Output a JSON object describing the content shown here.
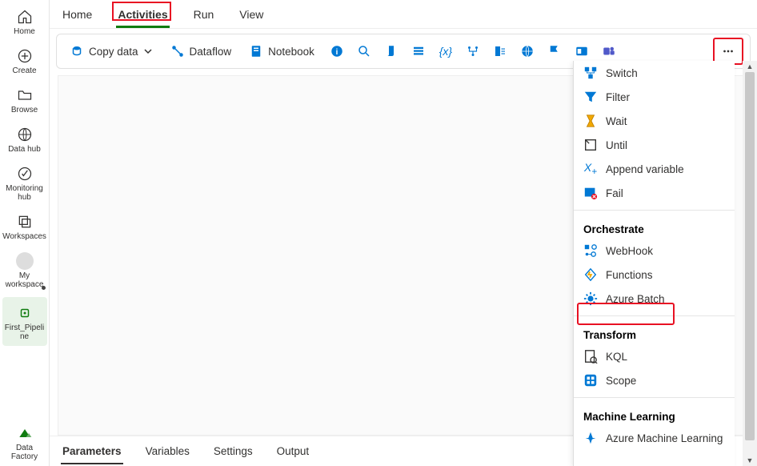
{
  "leftnav": {
    "items": [
      {
        "label": "Home",
        "icon": "home-icon"
      },
      {
        "label": "Create",
        "icon": "plus-circle-icon"
      },
      {
        "label": "Browse",
        "icon": "folder-icon"
      },
      {
        "label": "Data hub",
        "icon": "globe-icon"
      },
      {
        "label": "Monitoring\nhub",
        "icon": "monitor-icon"
      },
      {
        "label": "Workspaces",
        "icon": "workspaces-icon"
      },
      {
        "label": "My\nworkspace",
        "icon": "avatar-icon"
      },
      {
        "label": "First_Pipeli\nne",
        "icon": "pipeline-icon"
      }
    ],
    "footer": {
      "label": "Data Factory",
      "icon": "factory-icon"
    }
  },
  "tabs": {
    "items": [
      "Home",
      "Activities",
      "Run",
      "View"
    ],
    "active": 1
  },
  "toolbar": {
    "copy_data": "Copy data",
    "dataflow": "Dataflow",
    "notebook": "Notebook"
  },
  "bottom_tabs": {
    "items": [
      "Parameters",
      "Variables",
      "Settings",
      "Output"
    ],
    "active": 0
  },
  "dropdown": {
    "section1": [
      {
        "label": "Switch",
        "icon": "switch-icon"
      },
      {
        "label": "Filter",
        "icon": "filter-icon"
      },
      {
        "label": "Wait",
        "icon": "hourglass-icon"
      },
      {
        "label": "Until",
        "icon": "until-icon"
      },
      {
        "label": "Append variable",
        "icon": "append-var-icon"
      },
      {
        "label": "Fail",
        "icon": "fail-icon"
      }
    ],
    "orchestrate": {
      "label": "Orchestrate",
      "items": [
        {
          "label": "WebHook",
          "icon": "webhook-icon"
        },
        {
          "label": "Functions",
          "icon": "functions-icon"
        },
        {
          "label": "Azure Batch",
          "icon": "azure-batch-icon"
        }
      ]
    },
    "transform": {
      "label": "Transform",
      "items": [
        {
          "label": "KQL",
          "icon": "kql-icon"
        },
        {
          "label": "Scope",
          "icon": "scope-icon"
        }
      ]
    },
    "ml": {
      "label": "Machine Learning",
      "items": [
        {
          "label": "Azure Machine Learning",
          "icon": "aml-icon"
        }
      ]
    }
  },
  "highlight": {
    "item": "Azure Batch"
  }
}
